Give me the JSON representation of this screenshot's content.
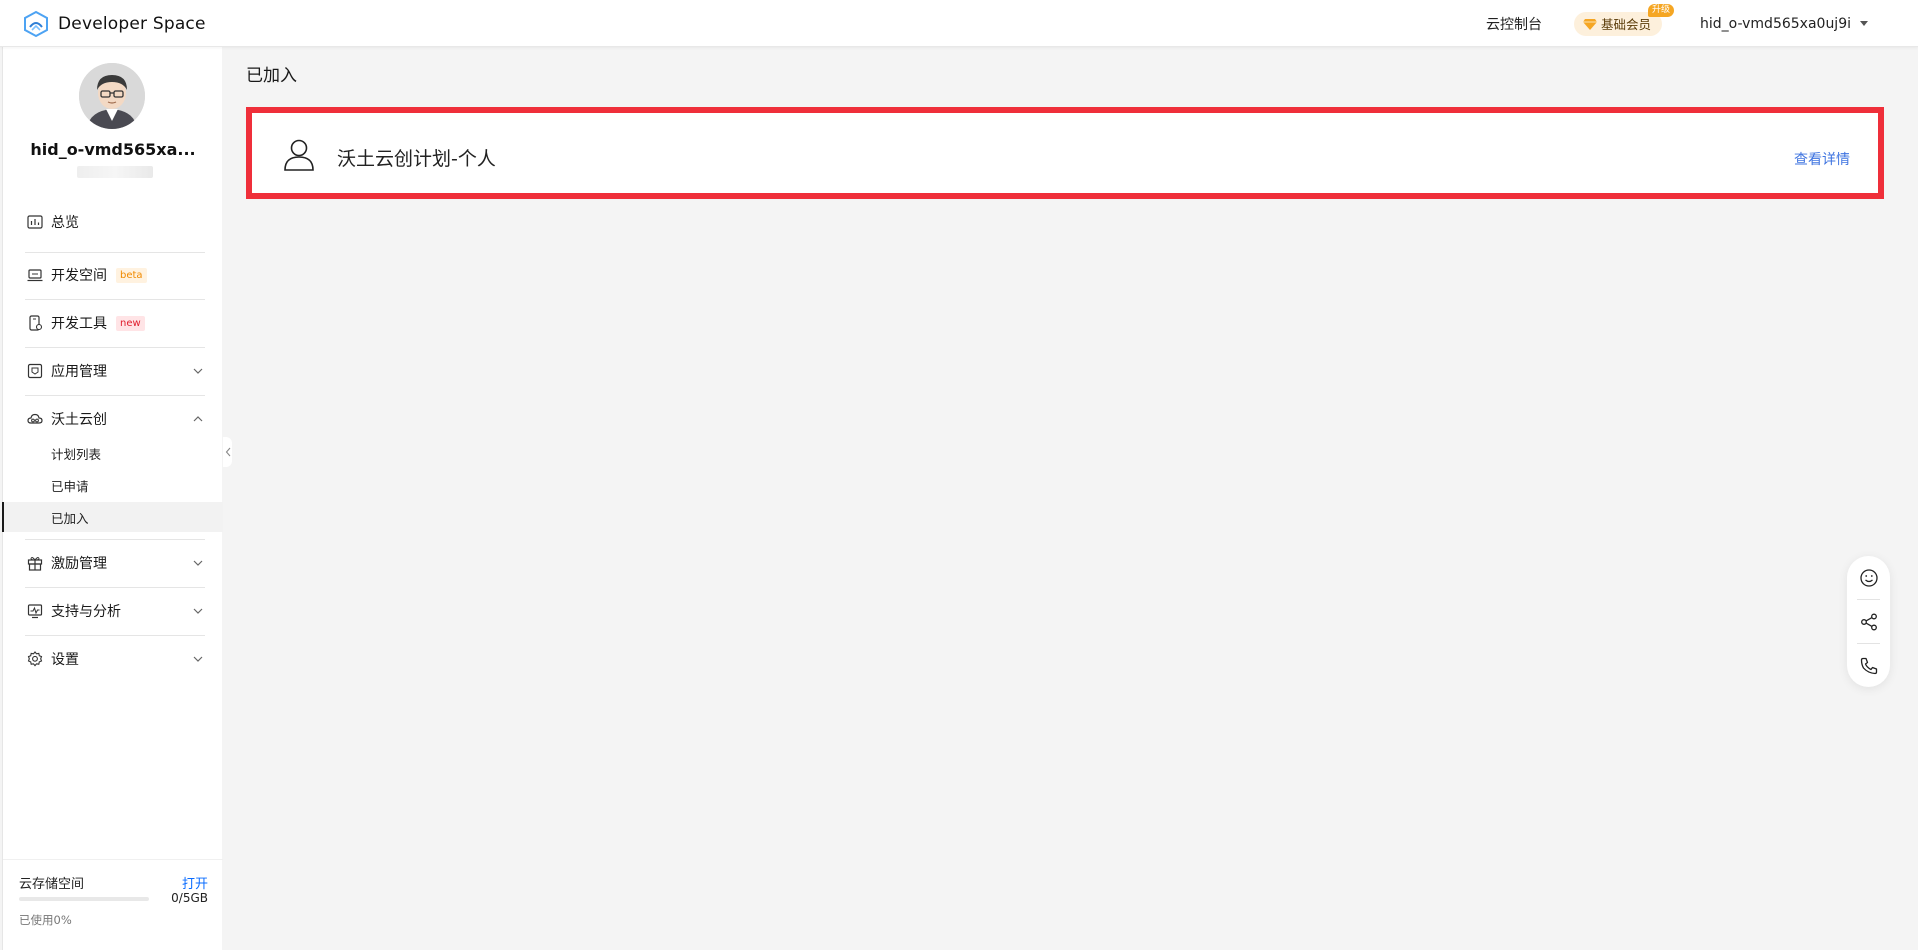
{
  "header": {
    "brand_name": "Developer Space",
    "console_link": "云控制台",
    "vip_label": "基础会员",
    "vip_upgrade_tag": "升级",
    "username": "hid_o-vmd565xa0uj9i"
  },
  "profile": {
    "name": "hid_o-vmd565xa..."
  },
  "sidebar": {
    "items": [
      {
        "label": "总览",
        "icon": "dashboard-icon"
      },
      {
        "label": "开发空间",
        "icon": "laptop-icon",
        "tag": "beta"
      },
      {
        "label": "开发工具",
        "icon": "tool-icon",
        "tag": "new"
      },
      {
        "label": "应用管理",
        "icon": "app-manage-icon"
      },
      {
        "label": "沃土云创",
        "icon": "cloud-icon"
      },
      {
        "label": "激励管理",
        "icon": "gift-icon"
      },
      {
        "label": "支持与分析",
        "icon": "analysis-icon"
      },
      {
        "label": "设置",
        "icon": "gear-icon"
      }
    ],
    "sub_items": [
      "计划列表",
      "已申请",
      "已加入"
    ],
    "active_sub_item": "已加入"
  },
  "storage": {
    "title": "云存储空间",
    "open_label": "打开",
    "size": "0/5GB",
    "used_text": "已使用0%",
    "used_fraction": 0
  },
  "main": {
    "page_title": "已加入",
    "plan": {
      "name": "沃土云创计划-个人",
      "link": "查看详情"
    }
  },
  "float_tools": [
    "smile-icon",
    "share-icon",
    "phone-icon"
  ],
  "colors": {
    "highlight_border": "#ef2f3a",
    "link": "#3f74e0",
    "storage_link": "#0a6cff",
    "vip_bg": "#fdf0dc",
    "vip_tag": "#f5a623"
  }
}
